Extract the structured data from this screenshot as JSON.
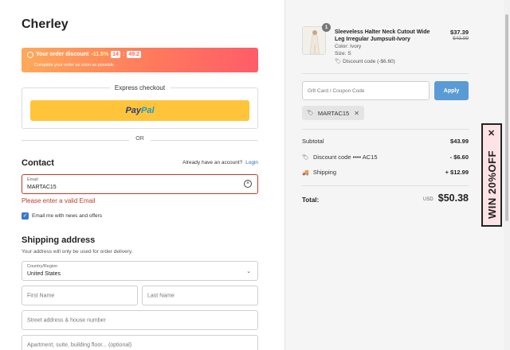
{
  "brand": "Cherley",
  "discount_banner": {
    "label": "Your order discount",
    "percent": "-11.5%",
    "time_h": "14",
    "time_colon": ":",
    "time_m": "49.2",
    "subtitle": "Complete your order as soon as possible"
  },
  "express": {
    "title": "Express checkout",
    "paypal_pay": "Pay",
    "paypal_pal": "Pal"
  },
  "or_text": "OR",
  "contact": {
    "title": "Contact",
    "have_account": "Already have an account?",
    "login": "Login",
    "email_label": "Email",
    "email_value": "MARTAC15",
    "error": "Please enter a valid Email",
    "newsletter": "Email me with news and offers"
  },
  "shipping": {
    "title": "Shipping address",
    "subtitle": "Your address will only be used for order delivery.",
    "country_label": "Country/Region",
    "country_value": "United States",
    "first_name_ph": "First Name",
    "last_name_ph": "Last Name",
    "street_ph": "Street address & house number",
    "apt_ph": "Apartment, suite, building floor... (optional)"
  },
  "product": {
    "qty": "1",
    "name": "Sleeveless Halter Neck Cutout Wide Leg Irregular Jumpsuit-Ivory",
    "color": "Color: Ivory",
    "size": "Size: S",
    "discount": "Discount code (-$6.60)",
    "price": "$37.39",
    "old_price": "$43.99"
  },
  "coupon": {
    "placeholder": "Gift Card / Coupon Code",
    "apply": "Apply",
    "applied_code": "MARTAC15"
  },
  "summary": {
    "subtotal_label": "Subtotal",
    "subtotal_value": "$43.99",
    "discount_label": "Discount code",
    "discount_code": "•••• AC15",
    "discount_value": "- $6.60",
    "shipping_label": "Shipping",
    "shipping_value": "+ $12.99",
    "total_label": "Total:",
    "total_currency": "USD",
    "total_value": "$50.38"
  },
  "win_tab": {
    "text": "WIN 20%OFF",
    "close": "✕"
  },
  "colors": {
    "accent_blue": "#5b9bd5",
    "error_red": "#c0392b",
    "paypal_yellow": "#ffc43a"
  }
}
